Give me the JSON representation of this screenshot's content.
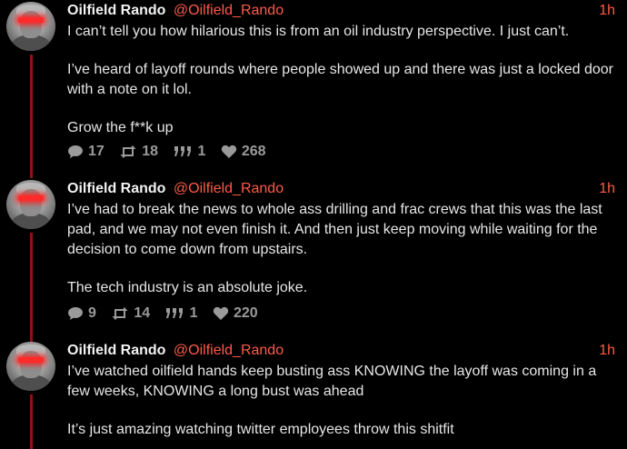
{
  "tweets": [
    {
      "author": {
        "name": "Oilfield Rando",
        "handle": "@Oilfield_Rando"
      },
      "time": "1h",
      "paragraphs": [
        "I can’t tell you how hilarious this is from an oil industry perspective. I just can’t.",
        "I’ve heard of layoff rounds where people showed up and there was just a locked door with a note on it lol.",
        "Grow the f**k up"
      ],
      "stats": {
        "replies": "17",
        "retweets": "18",
        "quotes": "1",
        "likes": "268"
      }
    },
    {
      "author": {
        "name": "Oilfield Rando",
        "handle": "@Oilfield_Rando"
      },
      "time": "1h",
      "paragraphs": [
        "I’ve had to break the news to whole ass drilling and frac crews that this was the last pad, and we may not even finish it. And then just keep moving while waiting for the decision to come down from upstairs.",
        "The tech industry is an absolute joke."
      ],
      "stats": {
        "replies": "9",
        "retweets": "14",
        "quotes": "1",
        "likes": "220"
      }
    },
    {
      "author": {
        "name": "Oilfield Rando",
        "handle": "@Oilfield_Rando"
      },
      "time": "1h",
      "paragraphs": [
        "I’ve watched oilfield hands keep busting ass KNOWING the layoff was coming in a few weeks, KNOWING a long bust was ahead",
        "It’s just amazing watching twitter employees throw this shitfit"
      ]
    }
  ],
  "icons": {
    "reply": "speech-bubble-icon",
    "retweet": "retweet-icon",
    "quote": "quote-icon",
    "like": "heart-icon",
    "avatar": "avatar-red-eyes"
  },
  "colors": {
    "background": "#000000",
    "text": "#e6e6e6",
    "accent": "#ff5a48",
    "thread_line": "#8a1414",
    "muted": "#9a9a9a"
  }
}
